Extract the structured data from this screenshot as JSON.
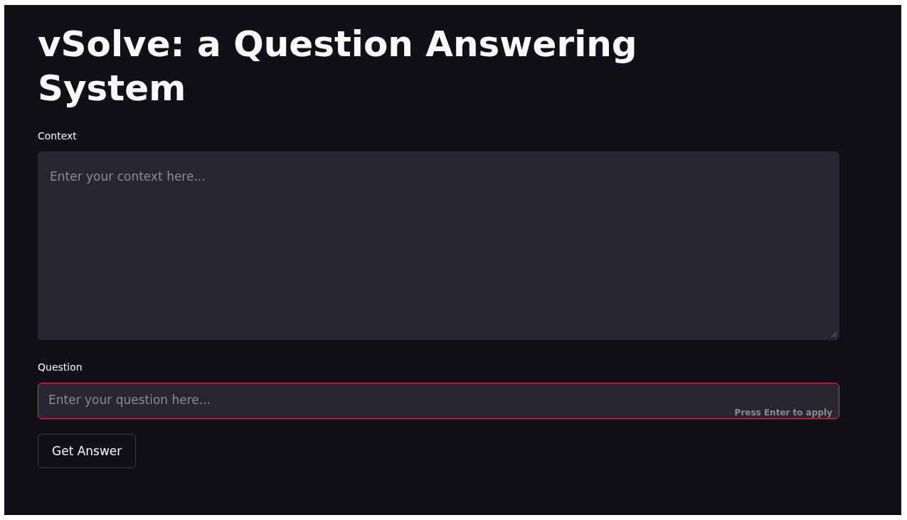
{
  "title": "vSolve: a Question Answering System",
  "context": {
    "label": "Context",
    "placeholder": "Enter your context here..."
  },
  "question": {
    "label": "Question",
    "placeholder": "Enter your question here...",
    "focused": true,
    "hint": "Press Enter to apply"
  },
  "buttons": [
    "Get Answer"
  ]
}
